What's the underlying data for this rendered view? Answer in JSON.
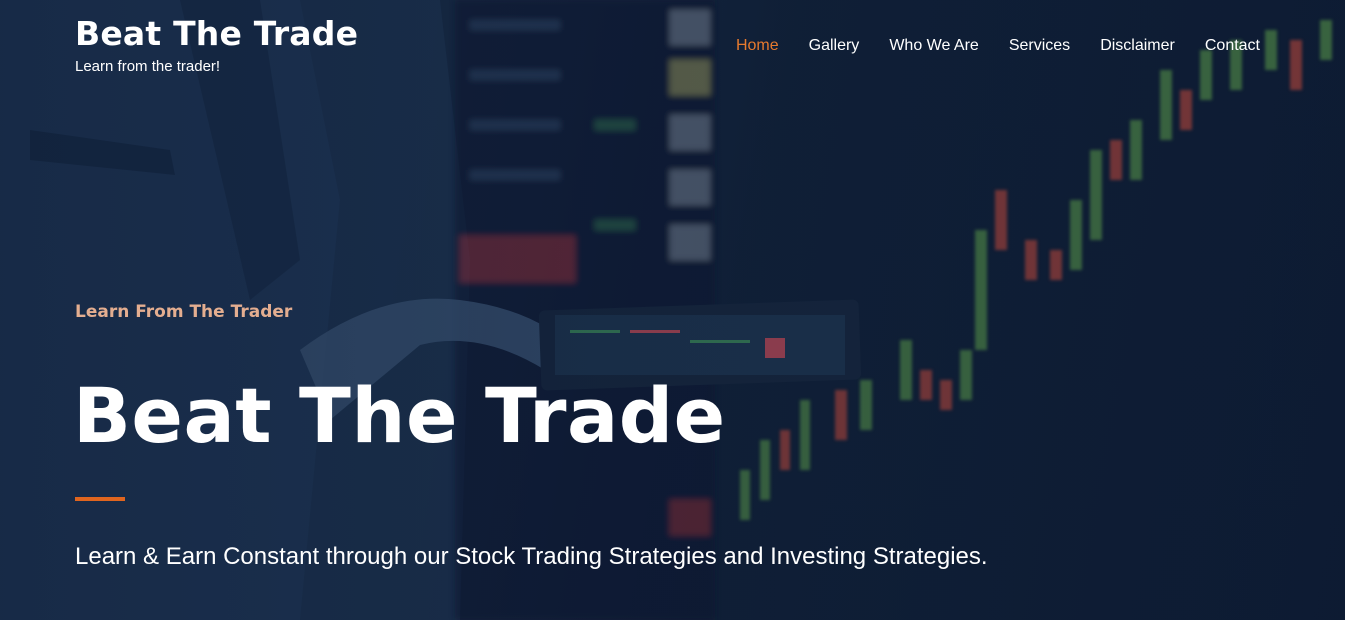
{
  "site": {
    "title": "Beat The Trade",
    "tagline": "Learn from the trader!"
  },
  "nav": {
    "items": [
      {
        "label": "Home",
        "active": true
      },
      {
        "label": "Gallery",
        "active": false
      },
      {
        "label": "Who We Are",
        "active": false
      },
      {
        "label": "Services",
        "active": false
      },
      {
        "label": "Disclaimer",
        "active": false
      },
      {
        "label": "Contact",
        "active": false
      }
    ]
  },
  "hero": {
    "eyebrow": "Learn From The Trader",
    "title": "Beat The Trade",
    "subtitle": "Learn & Earn Constant through our Stock Trading Strategies and Investing Strategies."
  },
  "colors": {
    "accent": "#e67a2e",
    "eyebrow": "#e4ae90",
    "rule": "#e0651f",
    "background": "#13243e"
  }
}
